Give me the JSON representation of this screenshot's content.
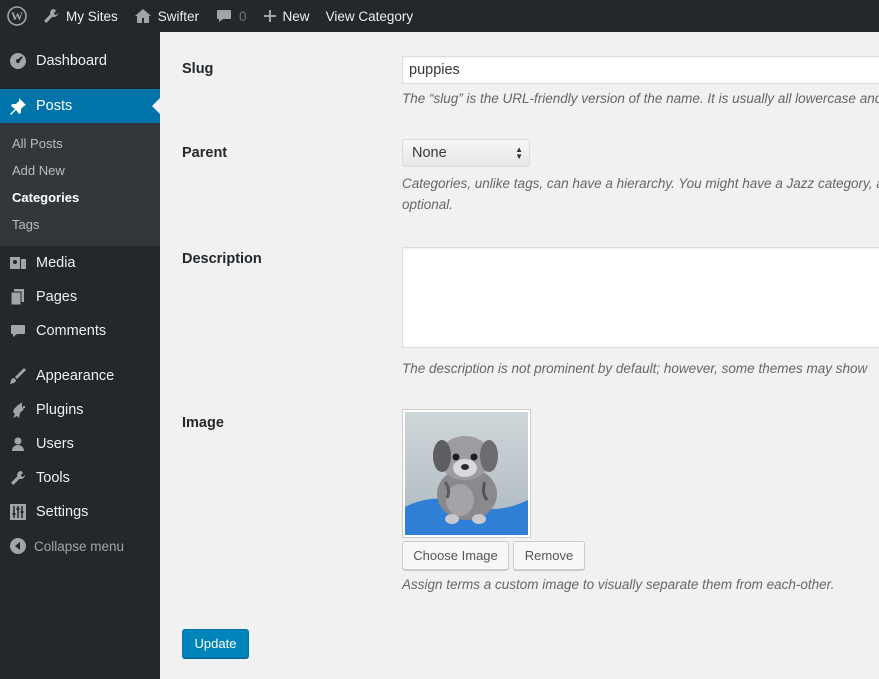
{
  "adminbar": {
    "wp_logo": "wordpress-logo",
    "my_sites": "My Sites",
    "site_name": "Swifter",
    "comments_count": "0",
    "new_label": "New",
    "view_label": "View Category"
  },
  "sidebar": {
    "dashboard": "Dashboard",
    "posts": "Posts",
    "posts_sub": [
      "All Posts",
      "Add New",
      "Categories",
      "Tags"
    ],
    "media": "Media",
    "pages": "Pages",
    "comments": "Comments",
    "appearance": "Appearance",
    "plugins": "Plugins",
    "users": "Users",
    "tools": "Tools",
    "settings": "Settings",
    "collapse": "Collapse menu"
  },
  "form": {
    "slug_label": "Slug",
    "slug_value": "puppies",
    "slug_desc": "The “slug” is the URL-friendly version of the name. It is usually all lowercase and",
    "parent_label": "Parent",
    "parent_value": "None",
    "parent_desc_line1": "Categories, unlike tags, can have a hierarchy. You might have a Jazz category, a",
    "parent_desc_line2": "optional.",
    "description_label": "Description",
    "description_value": "",
    "description_desc": "The description is not prominent by default; however, some themes may show",
    "image_label": "Image",
    "choose_image": "Choose Image",
    "remove": "Remove",
    "image_desc": "Assign terms a custom image to visually separate them from each-other.",
    "update": "Update"
  },
  "colors": {
    "admin_bg": "#23282d",
    "accent": "#0073aa",
    "submenu_bg": "#32373c"
  }
}
